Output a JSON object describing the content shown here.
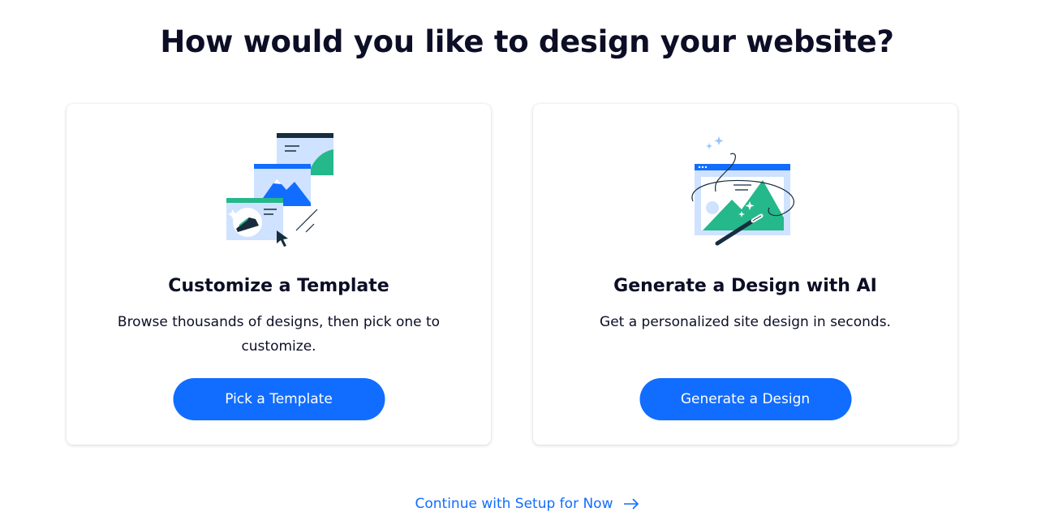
{
  "headline": "How would you like to design your website?",
  "cards": [
    {
      "title": "Customize a Template",
      "description": "Browse thousands of designs, then pick one to customize.",
      "button_label": "Pick a Template",
      "illustration_icon": "template-stack-illustration"
    },
    {
      "title": "Generate a Design with AI",
      "description": "Get a personalized site design in seconds.",
      "button_label": "Generate a Design",
      "illustration_icon": "ai-magic-wand-illustration"
    }
  ],
  "continue_link": {
    "label": "Continue with Setup for Now",
    "icon": "arrow-right-icon"
  },
  "colors": {
    "primary_blue": "#116dff",
    "text_dark": "#0c0e26",
    "light_blue": "#cfe2ff",
    "green": "#25b88a",
    "navy": "#162d3d"
  }
}
